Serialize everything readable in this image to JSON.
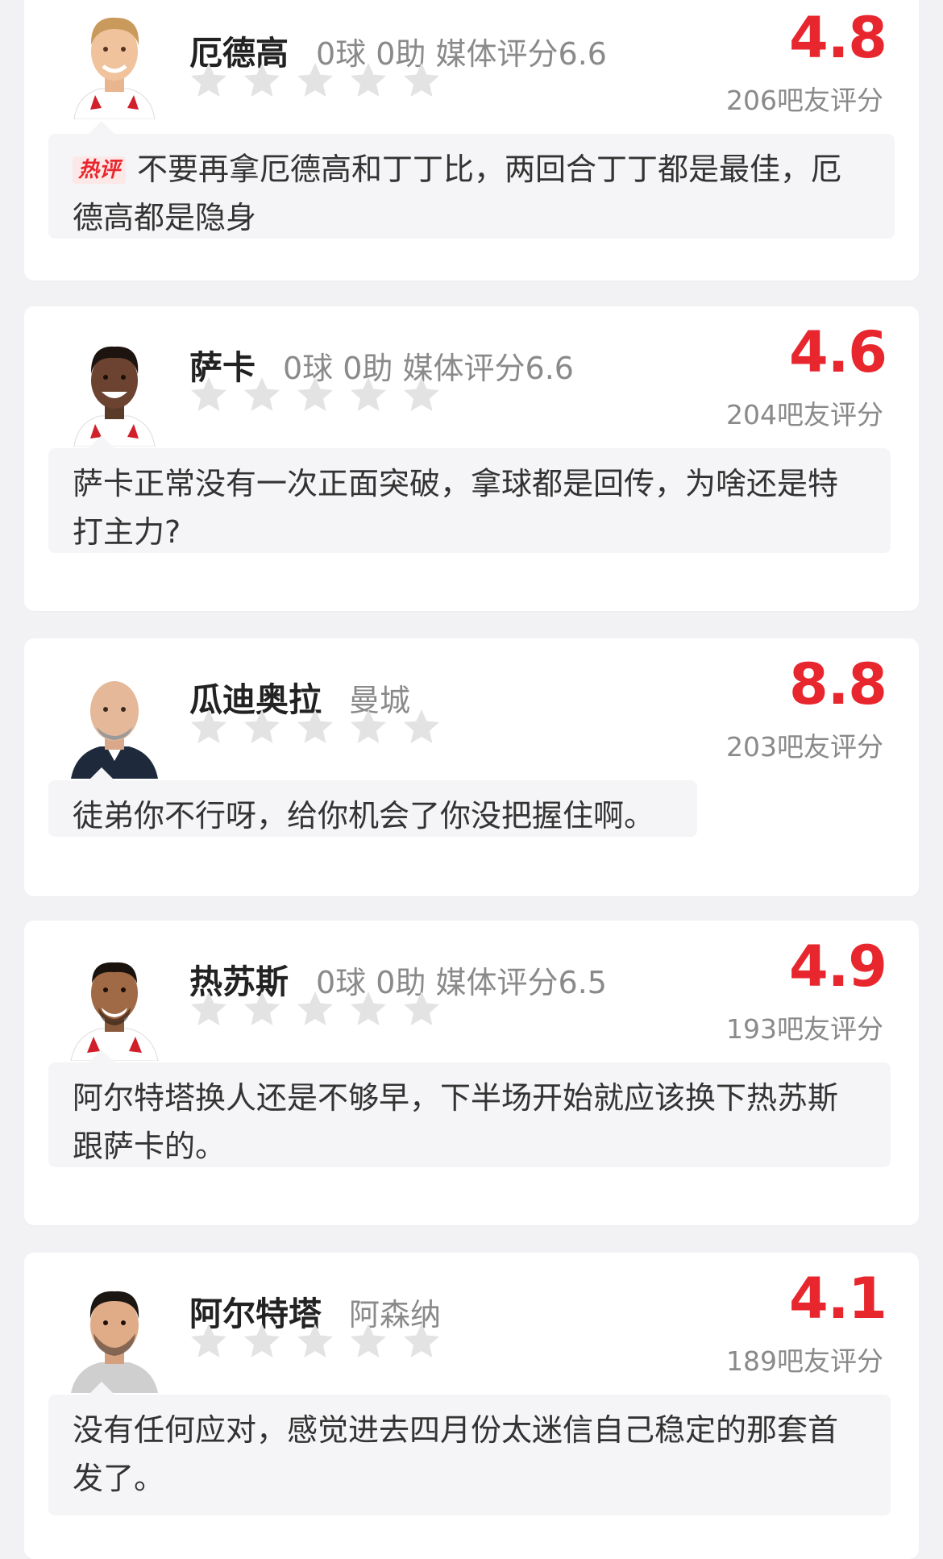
{
  "colors": {
    "score_red": "#e8262d",
    "star_gray": "#e3e3e3",
    "meta_gray": "#8a8a8a"
  },
  "cards": [
    {
      "name": "厄德高",
      "meta": "0球 0助  媒体评分6.6",
      "score": "4.8",
      "count": "206吧友评分",
      "hot": true,
      "hot_label": "热评",
      "comment": "不要再拿厄德高和丁丁比，两回合丁丁都是最佳，厄德高都是隐身",
      "stars_filled": 0,
      "stars_total": 5,
      "avatar_icon": "player-portrait-icon"
    },
    {
      "name": "萨卡",
      "meta": "0球 0助  媒体评分6.6",
      "score": "4.6",
      "count": "204吧友评分",
      "hot": false,
      "comment": "萨卡正常没有一次正面突破，拿球都是回传，为啥还是特打主力?",
      "stars_filled": 0,
      "stars_total": 5,
      "avatar_icon": "player-portrait-icon"
    },
    {
      "name": "瓜迪奥拉",
      "meta": "曼城",
      "score": "8.8",
      "count": "203吧友评分",
      "hot": false,
      "comment": "徒弟你不行呀，给你机会了你没把握住啊。",
      "stars_filled": 0,
      "stars_total": 5,
      "avatar_icon": "coach-portrait-icon"
    },
    {
      "name": "热苏斯",
      "meta": "0球 0助  媒体评分6.5",
      "score": "4.9",
      "count": "193吧友评分",
      "hot": false,
      "comment": "阿尔特塔换人还是不够早，下半场开始就应该换下热苏斯跟萨卡的。",
      "stars_filled": 0,
      "stars_total": 5,
      "avatar_icon": "player-portrait-icon"
    },
    {
      "name": "阿尔特塔",
      "meta": "阿森纳",
      "score": "4.1",
      "count": "189吧友评分",
      "hot": false,
      "comment": "没有任何应对，感觉进去四月份太迷信自己稳定的那套首发了。",
      "stars_filled": 0,
      "stars_total": 5,
      "avatar_icon": "coach-portrait-icon"
    }
  ]
}
